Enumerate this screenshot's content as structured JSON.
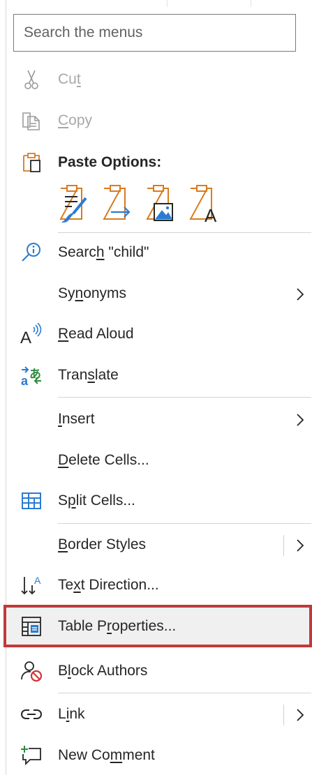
{
  "search": {
    "placeholder": "Search the menus"
  },
  "items": {
    "cut": {
      "pre": "Cu",
      "u": "t",
      "post": ""
    },
    "copy": {
      "pre": "",
      "u": "C",
      "post": "opy"
    },
    "paste_options": "Paste Options:",
    "search_child": {
      "pre": "Searc",
      "u": "h",
      "post": " \"child\""
    },
    "synonyms": {
      "pre": "Sy",
      "u": "n",
      "post": "onyms"
    },
    "read_aloud": {
      "pre": "",
      "u": "R",
      "post": "ead Aloud"
    },
    "translate": {
      "pre": "Tran",
      "u": "s",
      "post": "late"
    },
    "insert": {
      "pre": "",
      "u": "I",
      "post": "nsert"
    },
    "delete_cells": {
      "pre": "",
      "u": "D",
      "post": "elete Cells..."
    },
    "split_cells": {
      "pre": "S",
      "u": "p",
      "post": "lit Cells..."
    },
    "border_styles": {
      "pre": "",
      "u": "B",
      "post": "order Styles"
    },
    "text_direction": {
      "pre": "Te",
      "u": "x",
      "post": "t Direction..."
    },
    "table_properties": {
      "pre": "Table P",
      "u": "r",
      "post": "operties..."
    },
    "block_authors": {
      "pre": "B",
      "u": "l",
      "post": "ock Authors"
    },
    "link": {
      "pre": "L",
      "u": "i",
      "post": "nk"
    },
    "new_comment": {
      "pre": "New Co",
      "u": "m",
      "post": "ment"
    }
  },
  "icons": {
    "cut": "scissors-icon",
    "copy": "copy-icon",
    "paste": "clipboard-icon",
    "search": "smart-lookup-icon",
    "read_aloud": "read-aloud-icon",
    "translate": "translate-icon",
    "split_cells": "table-grid-icon",
    "text_direction": "text-direction-icon",
    "table_properties": "table-properties-icon",
    "block_authors": "block-authors-icon",
    "link": "link-icon",
    "new_comment": "new-comment-icon"
  },
  "colors": {
    "highlight_border": "#c0393b",
    "accent_blue": "#2b7bd3",
    "accent_orange": "#d97b1e",
    "block_red": "#d13438",
    "translate_green": "#2e8b3d"
  }
}
